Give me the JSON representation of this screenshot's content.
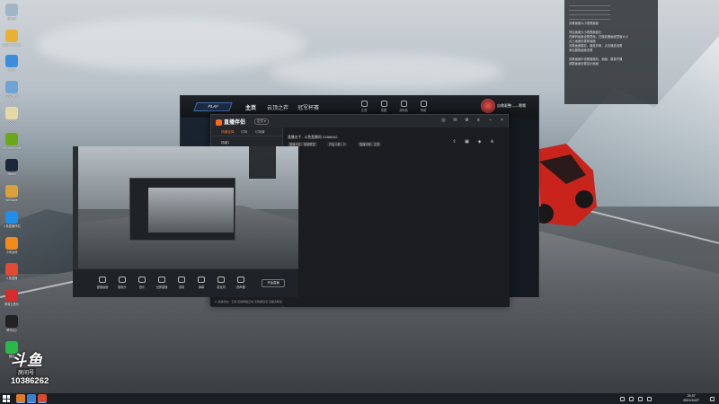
{
  "desktop_icons": [
    {
      "label": "回收站",
      "color": "#9fb6c9"
    },
    {
      "label": "Google Chrome",
      "color": "#e7b234"
    },
    {
      "label": "网络",
      "color": "#3a8edc"
    },
    {
      "label": "控制面板",
      "color": "#6fa3d6"
    },
    {
      "label": "文件",
      "color": "#e4d9a6"
    },
    {
      "label": "GeForce Experience",
      "color": "#6aa81a"
    },
    {
      "label": "Steam",
      "color": "#1b2838"
    },
    {
      "label": "WeGame",
      "color": "#d9a13a"
    },
    {
      "label": "斗鱼直播伴侣",
      "color": "#1f8fe8"
    },
    {
      "label": "小米运动",
      "color": "#f28b1b"
    },
    {
      "label": "斗鱼直播",
      "color": "#e24a32"
    },
    {
      "label": "网易云音乐",
      "color": "#d32d2d"
    },
    {
      "label": "腾讯QQ",
      "color": "#222222"
    },
    {
      "label": "微信",
      "color": "#2ab84a"
    }
  ],
  "watermark": {
    "brand": "斗鱼",
    "sub": "房间号",
    "room": "10386262"
  },
  "notification": {
    "lines": [
      "——————————————",
      "——————————————",
      "——————————————",
      "——————————————",
      "设置画面大小按照画面",
      "",
      "然后画面大小按照画面比",
      "在解码画面设置里面，在播放器画面里面大小",
      "点上画面设置那画面",
      "设置画面摄影，播放清晰，点击播放设置",
      "添加摄像画面设置",
      "",
      "设置画面中设置摄像机，画面，摄像开播",
      "调整画面设置显示画面"
    ]
  },
  "game_client": {
    "play_label": "PLAY",
    "nav": [
      "主页",
      "云顶之弈",
      "冠军杯赛"
    ],
    "tools": [
      "生涯",
      "收藏",
      "战利品",
      "商城"
    ],
    "user": "自救驱整——嗯哦"
  },
  "stream_app": {
    "logo": "直播伴侣",
    "version": "正式 ▾",
    "tabs": [
      "场景选择",
      "切场",
      "切场景"
    ],
    "scenes": [
      "场景1",
      "直播画面"
    ],
    "room_title": "直播名子 - 斗鱼直播间 10386262",
    "room_tags": [
      "直播分区：英雄联盟",
      "开启人数：0",
      "直播清晰：正常"
    ],
    "tools_label": "工具箱",
    "tools": [
      "直播助手",
      "发弹幕Ai",
      "主播任务",
      "视频直播",
      "主题推荐",
      "直播回放",
      "直播截图",
      "直播画面",
      "直播礼物"
    ],
    "bottom_buttons": [
      "直播画面",
      "摄像头",
      "音乐",
      "全屏直播",
      "录制",
      "弹幕",
      "麦克风",
      "扬声器"
    ],
    "start_button": "开始直播",
    "status_text": "0, 直播状态：正常 直播网络正常 无数据延迟 直播清晰度"
  },
  "taskbar": {
    "time": "20:37",
    "date": "2021/11/27"
  }
}
